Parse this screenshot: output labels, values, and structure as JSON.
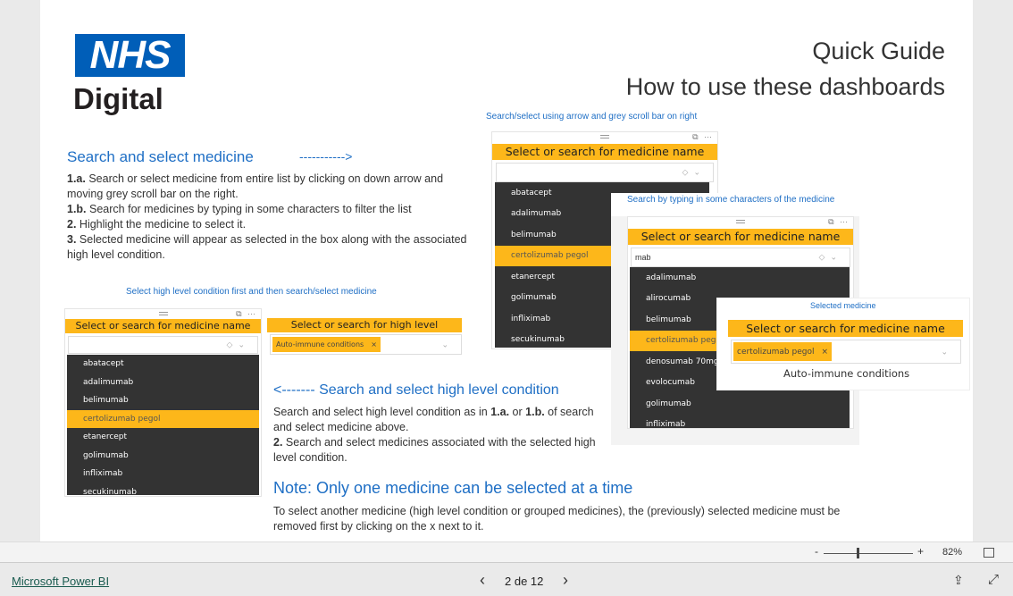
{
  "logo": {
    "line1": "NHS",
    "line2": "Digital",
    "color": "#005eb8"
  },
  "title": {
    "line1": "Quick Guide",
    "line2": "How to use these dashboards"
  },
  "section1": {
    "heading": "Search and select medicine",
    "arrow": "----------->",
    "steps": [
      {
        "num": "1.a.",
        "text": " Search or select medicine from entire list by clicking on down arrow and moving grey scroll bar on the right."
      },
      {
        "num": "1.b.",
        "text": " Search for medicines by typing in some characters to filter the list"
      },
      {
        "num": "2.",
        "text": " Highlight the medicine to select it."
      },
      {
        "num": "3.",
        "text": " Selected medicine will appear as selected in the box along with the associated high level condition."
      }
    ]
  },
  "caption_arrow": "Search/select using arrow and grey scroll bar on right",
  "caption_typing": "Search by typing in some characters of the medicine",
  "caption_selected": "Selected medicine",
  "caption_condition_first": "Select high level condition first and then search/select medicine",
  "slicer_title": "Select or search for medicine name",
  "condition_slicer_title": "Select or search for high level condition",
  "condition_chip": "Auto-immune conditions",
  "chip_close": "×",
  "list_full": [
    "abatacept",
    "adalimumab",
    "belimumab",
    "certolizumab pegol",
    "etanercept",
    "golimumab",
    "infliximab",
    "secukinumab"
  ],
  "search_value": "mab",
  "list_filtered": [
    "adalimumab",
    "alirocumab",
    "belimumab",
    "certolizumab pegol",
    "denosumab 70mg",
    "evolocumab",
    "golimumab",
    "infliximab"
  ],
  "selected_medicine": "certolizumab pegol",
  "selected_condition": "Auto-immune conditions",
  "section2": {
    "heading": "<------- Search and select high level condition",
    "p1a": "Search and select high level condition as in ",
    "p1b": "1.a.",
    "p1c": " or ",
    "p1d": "1.b.",
    "p1e": " of search and select medicine above.",
    "p2num": "2.",
    "p2": " Search and select medicines associated with the selected high level condition."
  },
  "note": {
    "heading": "Note: Only one medicine can be selected at a time",
    "text": "To select another medicine (high level condition or grouped medicines), the (previously) selected medicine must be removed first by clicking on the x next to it."
  },
  "zoom": {
    "minus": "-",
    "plus": "+",
    "level": "82%",
    "value": 82
  },
  "footer": {
    "brand": "Microsoft Power BI",
    "page": "2 de 12",
    "prev": "‹",
    "next": "›"
  },
  "colors": {
    "accent": "#fdb71a",
    "dark_list": "#333333",
    "heading_blue": "#1f6fc5"
  }
}
